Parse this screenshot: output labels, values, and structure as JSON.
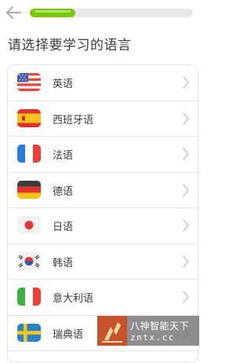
{
  "header": {
    "back_icon": "arrow-left-icon",
    "progress": 0.28
  },
  "title": "请选择要学习的语言",
  "languages": [
    {
      "label": "英语",
      "flag": "us-flag-icon"
    },
    {
      "label": "西班牙语",
      "flag": "spain-flag-icon"
    },
    {
      "label": "法语",
      "flag": "france-flag-icon"
    },
    {
      "label": "德语",
      "flag": "germany-flag-icon"
    },
    {
      "label": "日语",
      "flag": "japan-flag-icon"
    },
    {
      "label": "韩语",
      "flag": "korea-flag-icon"
    },
    {
      "label": "意大利语",
      "flag": "italy-flag-icon"
    },
    {
      "label": "瑞典语",
      "flag": "sweden-flag-icon"
    }
  ],
  "watermark": {
    "line1": "八神智能天下",
    "line2": "zntx.cc"
  },
  "colors": {
    "accent_green": "#78c800",
    "text": "#3c3c3c",
    "border": "#e4e4e4"
  }
}
